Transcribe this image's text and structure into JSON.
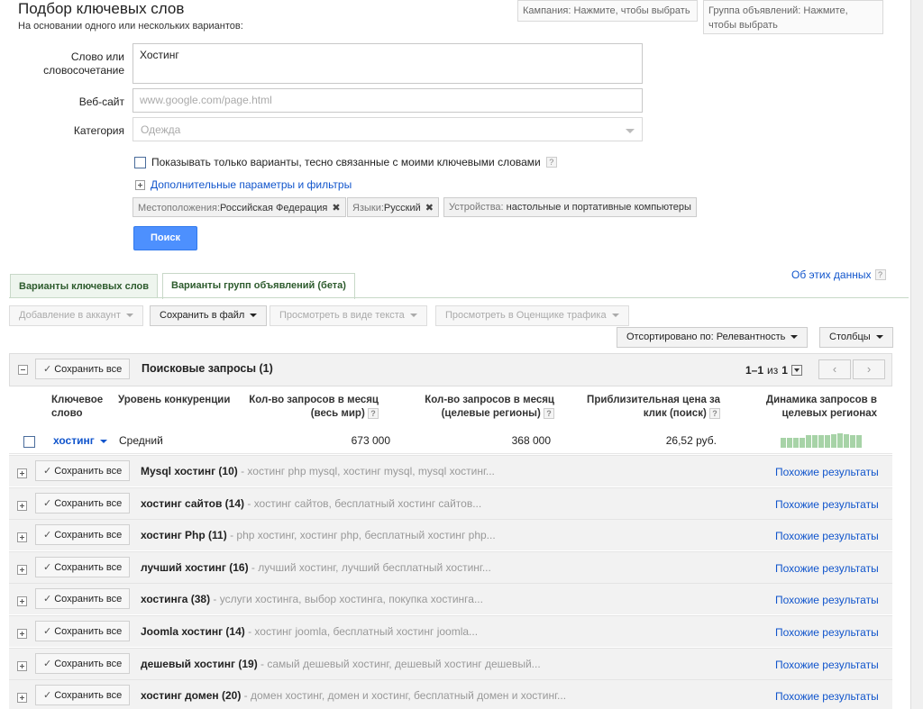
{
  "header": {
    "title": "Подбор ключевых слов",
    "subtitle": "На основании одного или нескольких вариантов:",
    "campaign_selector": "Кампания: Нажмите, чтобы выбрать",
    "adgroup_selector": "Группа объявлений: Нажмите, чтобы выбрать"
  },
  "form": {
    "keyword_label": "Слово или словосочетание",
    "keyword_value": "Хостинг",
    "website_label": "Веб-сайт",
    "website_placeholder": "www.google.com/page.html",
    "category_label": "Категория",
    "category_placeholder": "Одежда",
    "close_only_label": "Показывать только варианты, тесно связанные с моими ключевыми словами",
    "help": "?",
    "advanced_link": "Дополнительные параметры и фильтры",
    "chips": [
      {
        "key": "Местоположения:",
        "value": "Российская Федерация",
        "close": "✖"
      },
      {
        "key": "Языки:",
        "value": "Русский",
        "close": "✖"
      },
      {
        "key": "Устройства: ",
        "value": "настольные и портативные компьютеры"
      }
    ],
    "search_button": "Поиск"
  },
  "tabs": [
    {
      "label": "Варианты ключевых слов"
    },
    {
      "label": "Варианты групп объявлений (бета)"
    }
  ],
  "about_link": "Об этих данных",
  "toolbar": {
    "add_to_account": "Добавление в аккаунт",
    "save_to_file": "Сохранить в файл",
    "view_as_text": "Просмотреть в виде текста",
    "view_in_estimator": "Просмотреть в Оценщике трафика",
    "sorted_by": "Отсортировано по: Релевантность",
    "columns": "Столбцы"
  },
  "grid": {
    "save_all": "Сохранить все",
    "check": "✓",
    "section_title": "Поисковые запросы (1)",
    "pager_text": "1–1",
    "pager_of": "из",
    "pager_total": "1",
    "prev": "‹",
    "next": "›",
    "columns": {
      "keyword": "Ключевое слово",
      "competition": "Уровень конкуренции",
      "global": "Кол-во запросов в месяц (весь мир)",
      "local": "Кол-во запросов в месяц (целевые регионы)",
      "cpc": "Приблизительная цена за клик (поиск)",
      "trend": "Динамика запросов в целевых регионах"
    },
    "keyword_row": {
      "keyword": "хостинг",
      "competition": "Средний",
      "global": "673 000",
      "local": "368 000",
      "cpc": "26,52 руб.",
      "trend": [
        70,
        70,
        70,
        70,
        85,
        85,
        85,
        90,
        95,
        100,
        95,
        90,
        85
      ]
    },
    "similar_label": "Похожие результаты",
    "groups": [
      {
        "name": "Mysql хостинг (10)",
        "sub": " - хостинг php mysql, хостинг mysql, mysql хостинг..."
      },
      {
        "name": "хостинг сайтов (14)",
        "sub": " - хостинг сайтов, бесплатный хостинг сайтов..."
      },
      {
        "name": "хостинг Php (11)",
        "sub": " - php хостинг, хостинг php, бесплатный хостинг php..."
      },
      {
        "name": "лучший хостинг (16)",
        "sub": " - лучший хостинг, лучший бесплатный хостинг..."
      },
      {
        "name": "хостинга (38)",
        "sub": " - услуги хостинга, выбор хостинга, покупка хостинга..."
      },
      {
        "name": "Joomla хостинг (14)",
        "sub": " - хостинг joomla, бесплатный хостинг joomla..."
      },
      {
        "name": "дешевый хостинг (19)",
        "sub": " - самый дешевый хостинг, дешевый хостинг дешевый..."
      },
      {
        "name": "хостинг домен (20)",
        "sub": " - домен хостинг, домен и хостинг, бесплатный домен и хостинг..."
      }
    ]
  }
}
